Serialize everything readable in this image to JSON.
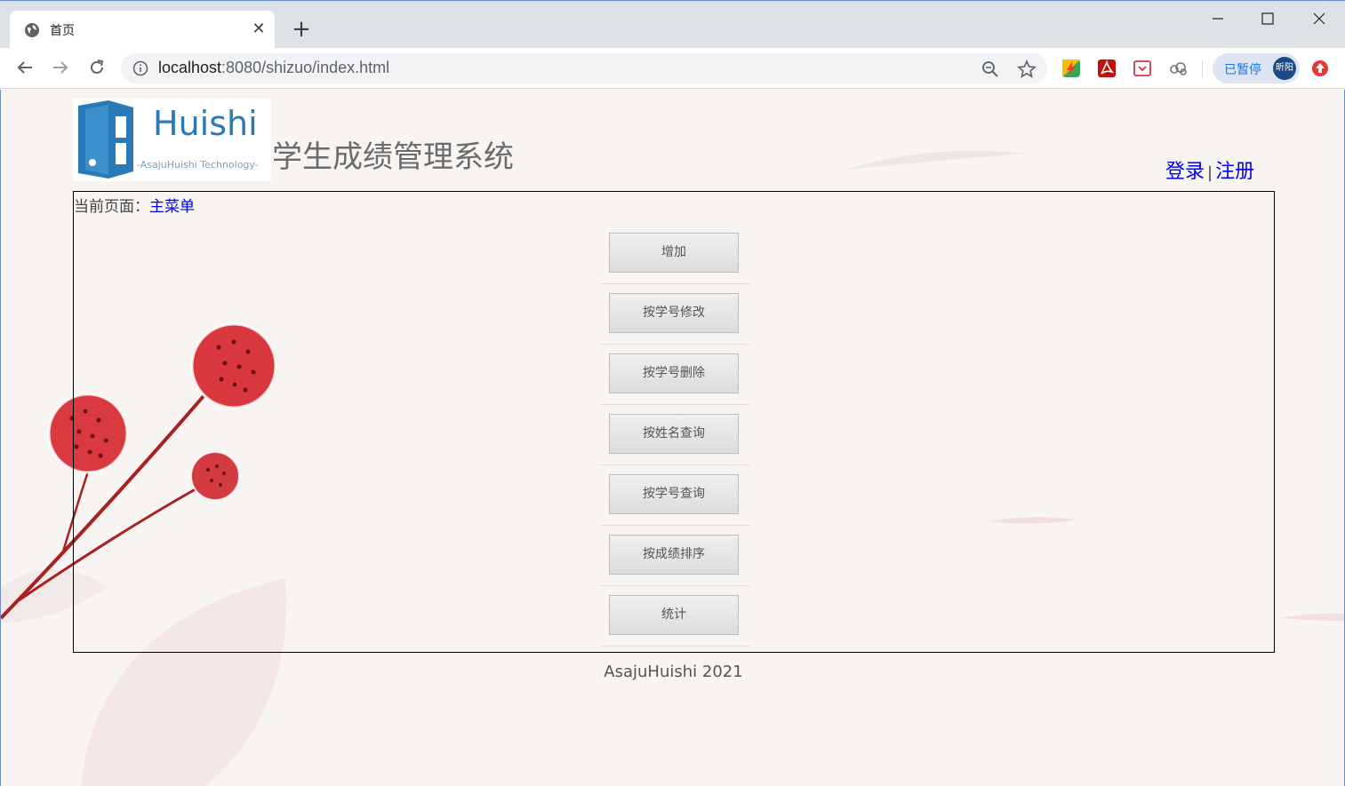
{
  "browser": {
    "tab_title": "首页",
    "url_host": "localhost",
    "url_rest": ":8080/shizuo/index.html",
    "profile_status": "已暂停",
    "profile_avatar_text": "昕阳"
  },
  "header": {
    "logo_brand": "Huishi",
    "logo_tagline": "-AsajuHuishi Technology-",
    "title": "学生成绩管理系统",
    "login": "登录",
    "separator": "|",
    "register": "注册"
  },
  "breadcrumb": {
    "prefix": "当前页面：",
    "current": "主菜单"
  },
  "menu": [
    {
      "label": "增加"
    },
    {
      "label": "按学号修改"
    },
    {
      "label": "按学号删除"
    },
    {
      "label": "按姓名查询"
    },
    {
      "label": "按学号查询"
    },
    {
      "label": "按成绩排序"
    },
    {
      "label": "统计"
    }
  ],
  "footer": {
    "text": "AsajuHuishi 2021"
  },
  "colors": {
    "link": "#0000ee",
    "logo_blue": "#2b7ab8",
    "accent_red": "#c0282c"
  }
}
